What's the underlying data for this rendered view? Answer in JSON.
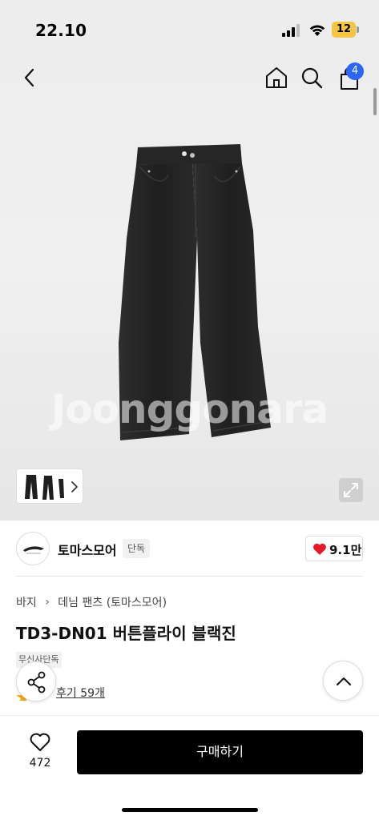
{
  "status_bar": {
    "time": "22.10",
    "battery_level": "12"
  },
  "header": {
    "back_icon": "chevron-left-icon",
    "home_icon": "home-icon",
    "search_icon": "search-icon",
    "cart_icon": "shopping-bag-icon",
    "cart_badge": "4"
  },
  "hero": {
    "watermark": "Joonggonara",
    "accent_color": "#2b66f6"
  },
  "brand": {
    "name": "토마스모어",
    "tag": "단독",
    "like_count": "9.1만",
    "heart_color": "#e5192a"
  },
  "product": {
    "breadcrumb": [
      "바지",
      "데님 팬츠 (토마스모어)"
    ],
    "title": "TD3-DN01 버튼플라이 블랙진",
    "exclusive_badge": "무신사단독",
    "review_text": "후기 59개"
  },
  "bottom_bar": {
    "wish_count": "472",
    "buy_label": "구매하기"
  }
}
